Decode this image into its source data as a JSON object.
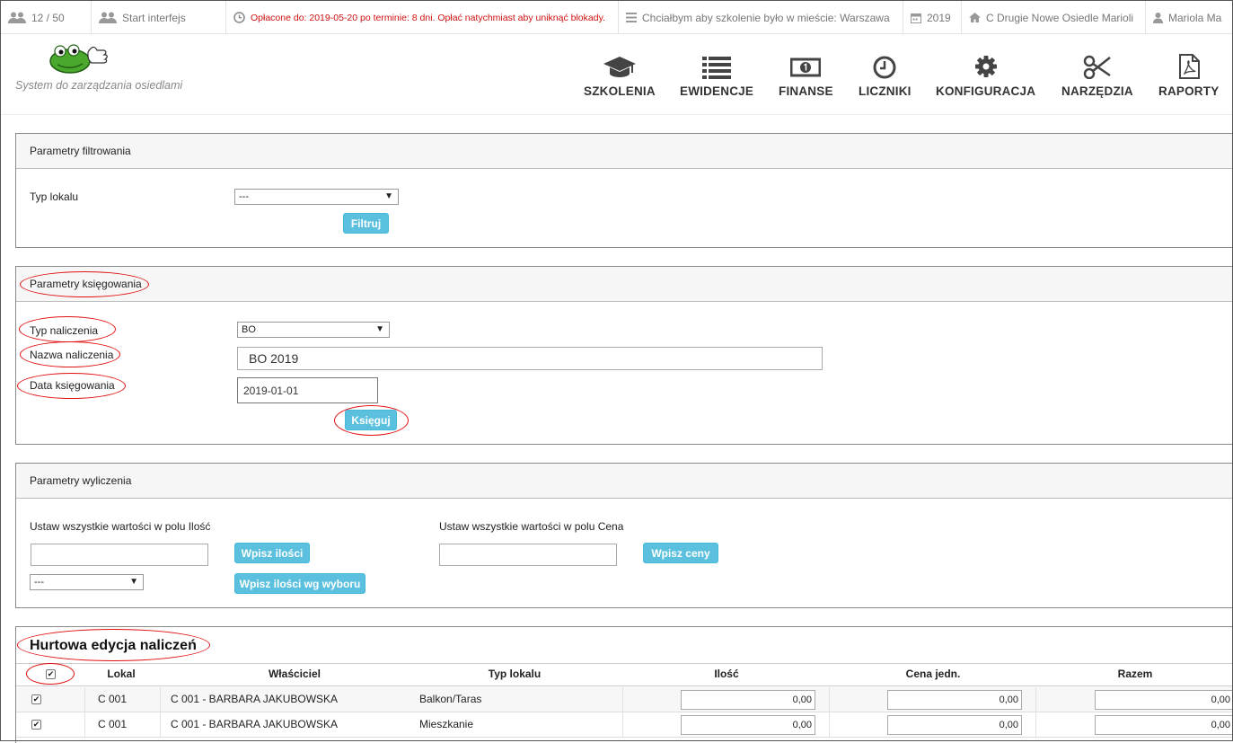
{
  "topbar": {
    "users": "12 / 50",
    "start": "Start interfejs",
    "payment_notice": "Opłacone do: 2019-05-20 po terminie: 8 dni. Opłać natychmiast aby uniknąć blokady.",
    "training_request": "Chciałbym aby szkolenie było w mieście: Warszawa",
    "year": "2019",
    "estate": "C Drugie Nowe Osiedle Marioli",
    "user": "Mariola Ma"
  },
  "header": {
    "tagline": "System do zarządzania osiedlami",
    "nav": [
      "SZKOLENIA",
      "EWIDENCJE",
      "FINANSE",
      "LICZNIKI",
      "KONFIGURACJA",
      "NARZĘDZIA",
      "RAPORTY"
    ]
  },
  "filter": {
    "title": "Parametry filtrowania",
    "type_label": "Typ lokalu",
    "type_value": "---",
    "button": "Filtruj"
  },
  "booking": {
    "title": "Parametry księgowania",
    "charge_type_label": "Typ naliczenia",
    "charge_type_value": "BO",
    "charge_name_label": "Nazwa naliczenia",
    "charge_name_value": "BO 2019",
    "date_label": "Data księgowania",
    "date_value": "2019-01-01",
    "button": "Księguj"
  },
  "calc": {
    "title": "Parametry wyliczenia",
    "qty_label": "Ustaw wszystkie wartości w polu Ilość",
    "price_label": "Ustaw wszystkie wartości w polu Cena",
    "qty_button": "Wpisz ilości",
    "qty_select_value": "---",
    "qty_by_choice_button": "Wpisz ilości wg wyboru",
    "price_button": "Wpisz ceny"
  },
  "bulk": {
    "title": "Hurtowa edycja naliczeń",
    "headers": [
      "Lokal",
      "Właściciel",
      "Typ lokalu",
      "Ilość",
      "Cena jedn.",
      "Razem"
    ],
    "rows": [
      {
        "lokal": "C 001",
        "owner": "C 001 - BARBARA JAKUBOWSKA",
        "type": "Balkon/Taras",
        "qty": "0,00",
        "price": "0,00",
        "total": "0,00"
      },
      {
        "lokal": "C 001",
        "owner": "C 001 - BARBARA JAKUBOWSKA",
        "type": "Mieszkanie",
        "qty": "0,00",
        "price": "0,00",
        "total": "0,00"
      }
    ]
  },
  "colors": {
    "accent_button": "#5bc0de",
    "alert_text": "#d01010",
    "annotation_oval": "#e01010"
  }
}
